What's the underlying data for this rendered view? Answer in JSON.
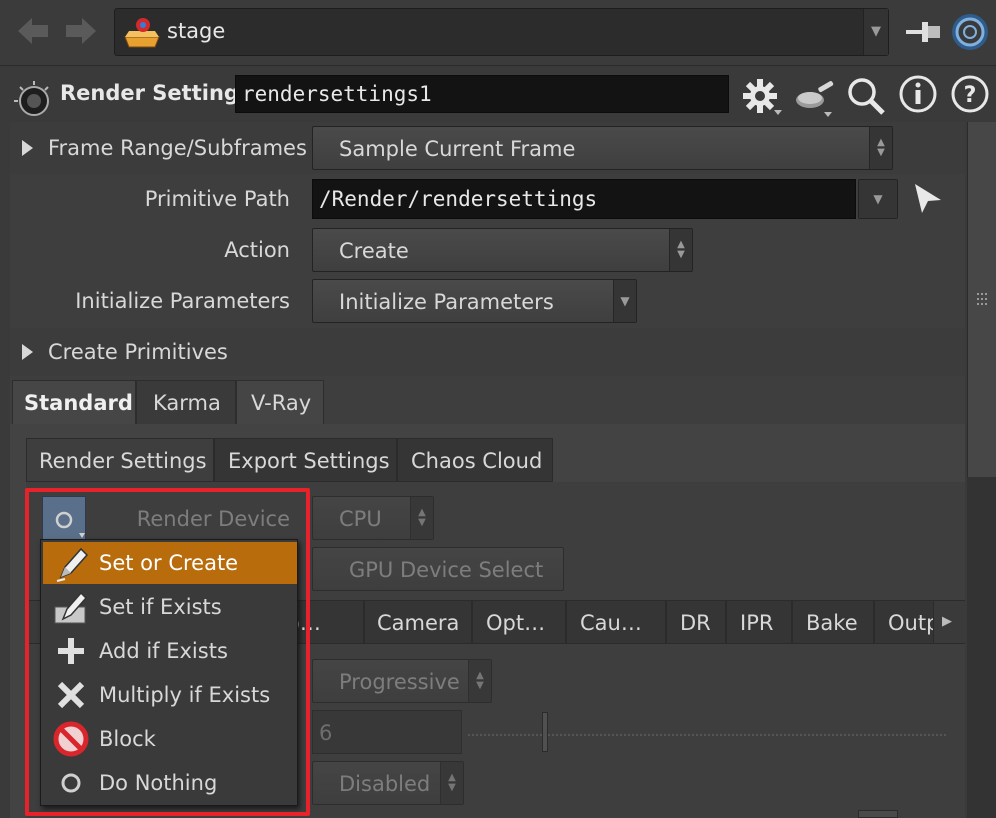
{
  "topbar": {
    "path_label": "stage",
    "back_icon": "back-arrow-icon",
    "forward_icon": "forward-arrow-icon"
  },
  "header": {
    "node_type": "Render Settings",
    "node_name": "rendersettings1"
  },
  "params": {
    "frame_range_label": "Frame Range/Subframes",
    "frame_range_value": "Sample Current Frame",
    "primitive_path_label": "Primitive Path",
    "primitive_path_value": "/Render/rendersettings",
    "action_label": "Action",
    "action_value": "Create",
    "init_params_label": "Initialize Parameters",
    "init_params_value": "Initialize Parameters",
    "create_primitives_label": "Create Primitives"
  },
  "tabs": [
    "Standard",
    "Karma",
    "V-Ray"
  ],
  "subtabs": [
    "Render Settings",
    "Export Settings",
    "Chaos Cloud"
  ],
  "render_device": {
    "label": "Render Device",
    "value": "CPU",
    "gpu_select": "GPU Device Select"
  },
  "vray_tabs": [
    "o…",
    "Camera",
    "Opt…",
    "Cau…",
    "DR",
    "IPR",
    "Bake",
    "Outp"
  ],
  "lower": {
    "mode_value": "Progressive",
    "number_value": "6",
    "disabled_value": "Disabled"
  },
  "popup": {
    "items": [
      {
        "label": "Set or Create",
        "icon": "pencil-icon"
      },
      {
        "label": "Set if Exists",
        "icon": "pencil-box-icon"
      },
      {
        "label": "Add if Exists",
        "icon": "plus-icon"
      },
      {
        "label": "Multiply if Exists",
        "icon": "multiply-icon"
      },
      {
        "label": "Block",
        "icon": "block-icon"
      },
      {
        "label": "Do Nothing",
        "icon": "circle-icon"
      }
    ]
  },
  "colors": {
    "highlight": "#b86c0c",
    "annotation_box": "#e8222a",
    "background": "#3a3a3a"
  }
}
